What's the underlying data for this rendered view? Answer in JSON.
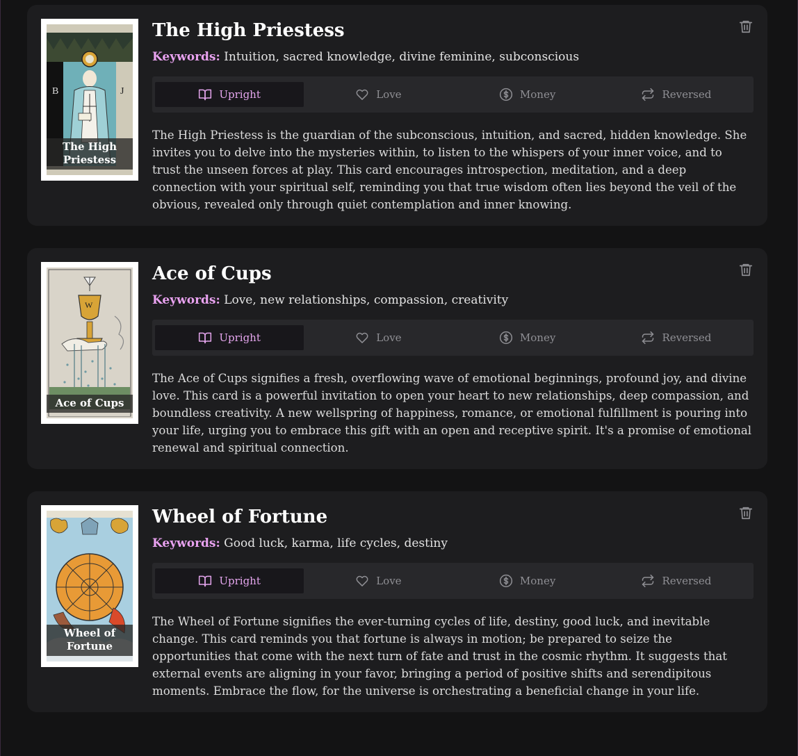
{
  "cards": [
    {
      "name": "The High Priestess",
      "thumb_label": "The High Priestess",
      "keywords_label": "Keywords:",
      "keywords": "Intuition, sacred knowledge, divine feminine, subconscious",
      "description": "The High Priestess is the guardian of the subconscious, intuition, and sacred, hidden knowledge. She invites you to delve into the mysteries within, to listen to the whispers of your inner voice, and to trust the unseen forces at play. This card encourages introspection, meditation, and a deep connection with your spiritual self, reminding you that true wisdom often lies beyond the veil of the obvious, revealed only through quiet contemplation and inner knowing."
    },
    {
      "name": "Ace of Cups",
      "thumb_label": "Ace of Cups",
      "keywords_label": "Keywords:",
      "keywords": "Love, new relationships, compassion, creativity",
      "description": "The Ace of Cups signifies a fresh, overflowing wave of emotional beginnings, profound joy, and divine love. This card is a powerful invitation to open your heart to new relationships, deep compassion, and boundless creativity. A new wellspring of happiness, romance, or emotional fulfillment is pouring into your life, urging you to embrace this gift with an open and receptive spirit. It's a promise of emotional renewal and spiritual connection."
    },
    {
      "name": "Wheel of Fortune",
      "thumb_label": "Wheel of Fortune",
      "keywords_label": "Keywords:",
      "keywords": "Good luck, karma, life cycles, destiny",
      "description": "The Wheel of Fortune signifies the ever-turning cycles of life, destiny, good luck, and inevitable change. This card reminds you that fortune is always in motion; be prepared to seize the opportunities that come with the next turn of fate and trust in the cosmic rhythm. It suggests that external events are aligning in your favor, bringing a period of positive shifts and serendipitous moments. Embrace the flow, for the universe is orchestrating a beneficial change in your life."
    }
  ],
  "tabs": [
    {
      "label": "Upright",
      "icon": "book-open-icon"
    },
    {
      "label": "Love",
      "icon": "heart-icon"
    },
    {
      "label": "Money",
      "icon": "dollar-circle-icon"
    },
    {
      "label": "Reversed",
      "icon": "repeat-icon"
    }
  ],
  "active_tab": "Upright",
  "colors": {
    "accent": "#e5a6ee",
    "keywords_label": "#e9a2f0",
    "card_bg": "#1d1d1f",
    "tab_bar_bg": "#28282b"
  }
}
